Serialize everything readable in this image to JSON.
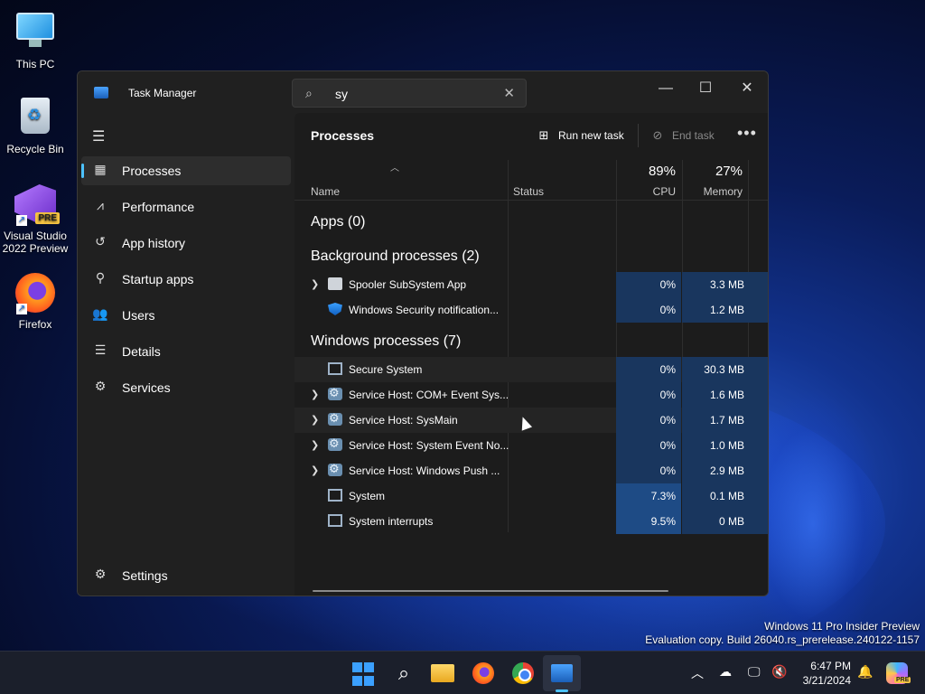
{
  "desktop": {
    "icons": [
      {
        "label": "This PC"
      },
      {
        "label": "Recycle Bin"
      },
      {
        "label": "Visual Studio 2022 Preview",
        "badge": "PRE"
      },
      {
        "label": "Firefox"
      }
    ],
    "watermark": {
      "line1": "Windows 11 Pro Insider Preview",
      "line2": "Evaluation copy. Build 26040.rs_prerelease.240122-1157"
    }
  },
  "window": {
    "title": "Task Manager",
    "search": {
      "value": "sy"
    },
    "controls": {
      "minimize": "—",
      "maximize": "☐",
      "close": "✕"
    }
  },
  "sidebar": {
    "items": [
      {
        "label": "Processes",
        "icon": "processes-icon",
        "active": true
      },
      {
        "label": "Performance",
        "icon": "performance-icon"
      },
      {
        "label": "App history",
        "icon": "app-history-icon"
      },
      {
        "label": "Startup apps",
        "icon": "startup-apps-icon"
      },
      {
        "label": "Users",
        "icon": "users-icon"
      },
      {
        "label": "Details",
        "icon": "details-icon"
      },
      {
        "label": "Services",
        "icon": "services-icon"
      }
    ],
    "settings": "Settings"
  },
  "content": {
    "title": "Processes",
    "run_new_task": "Run new task",
    "end_task": "End task",
    "columns": {
      "name": "Name",
      "status": "Status",
      "cpu_pct": "89%",
      "cpu": "CPU",
      "mem_pct": "27%",
      "memory": "Memory"
    },
    "groups": {
      "apps": "Apps (0)",
      "background": "Background processes (2)",
      "windows": "Windows processes (7)"
    },
    "background_rows": [
      {
        "name": "Spooler SubSystem App",
        "cpu": "0%",
        "memory": "3.3 MB",
        "expandable": true,
        "icon": "printer-icon"
      },
      {
        "name": "Windows Security notification...",
        "cpu": "0%",
        "memory": "1.2 MB",
        "expandable": false,
        "icon": "shield-icon"
      }
    ],
    "windows_rows": [
      {
        "name": "Secure System",
        "cpu": "0%",
        "memory": "30.3 MB",
        "expandable": false,
        "icon": "window-icon"
      },
      {
        "name": "Service Host: COM+ Event Sys...",
        "cpu": "0%",
        "memory": "1.6 MB",
        "expandable": true,
        "icon": "gear-icon"
      },
      {
        "name": "Service Host: SysMain",
        "cpu": "0%",
        "memory": "1.7 MB",
        "expandable": true,
        "icon": "gear-icon"
      },
      {
        "name": "Service Host: System Event No...",
        "cpu": "0%",
        "memory": "1.0 MB",
        "expandable": true,
        "icon": "gear-icon"
      },
      {
        "name": "Service Host: Windows Push ...",
        "cpu": "0%",
        "memory": "2.9 MB",
        "expandable": true,
        "icon": "gear-icon"
      },
      {
        "name": "System",
        "cpu": "7.3%",
        "memory": "0.1 MB",
        "expandable": false,
        "icon": "window-icon"
      },
      {
        "name": "System interrupts",
        "cpu": "9.5%",
        "memory": "0 MB",
        "expandable": false,
        "icon": "window-icon"
      }
    ]
  },
  "taskbar": {
    "time": "6:47 PM",
    "date": "3/21/2024",
    "copilot_badge": "PRE"
  }
}
